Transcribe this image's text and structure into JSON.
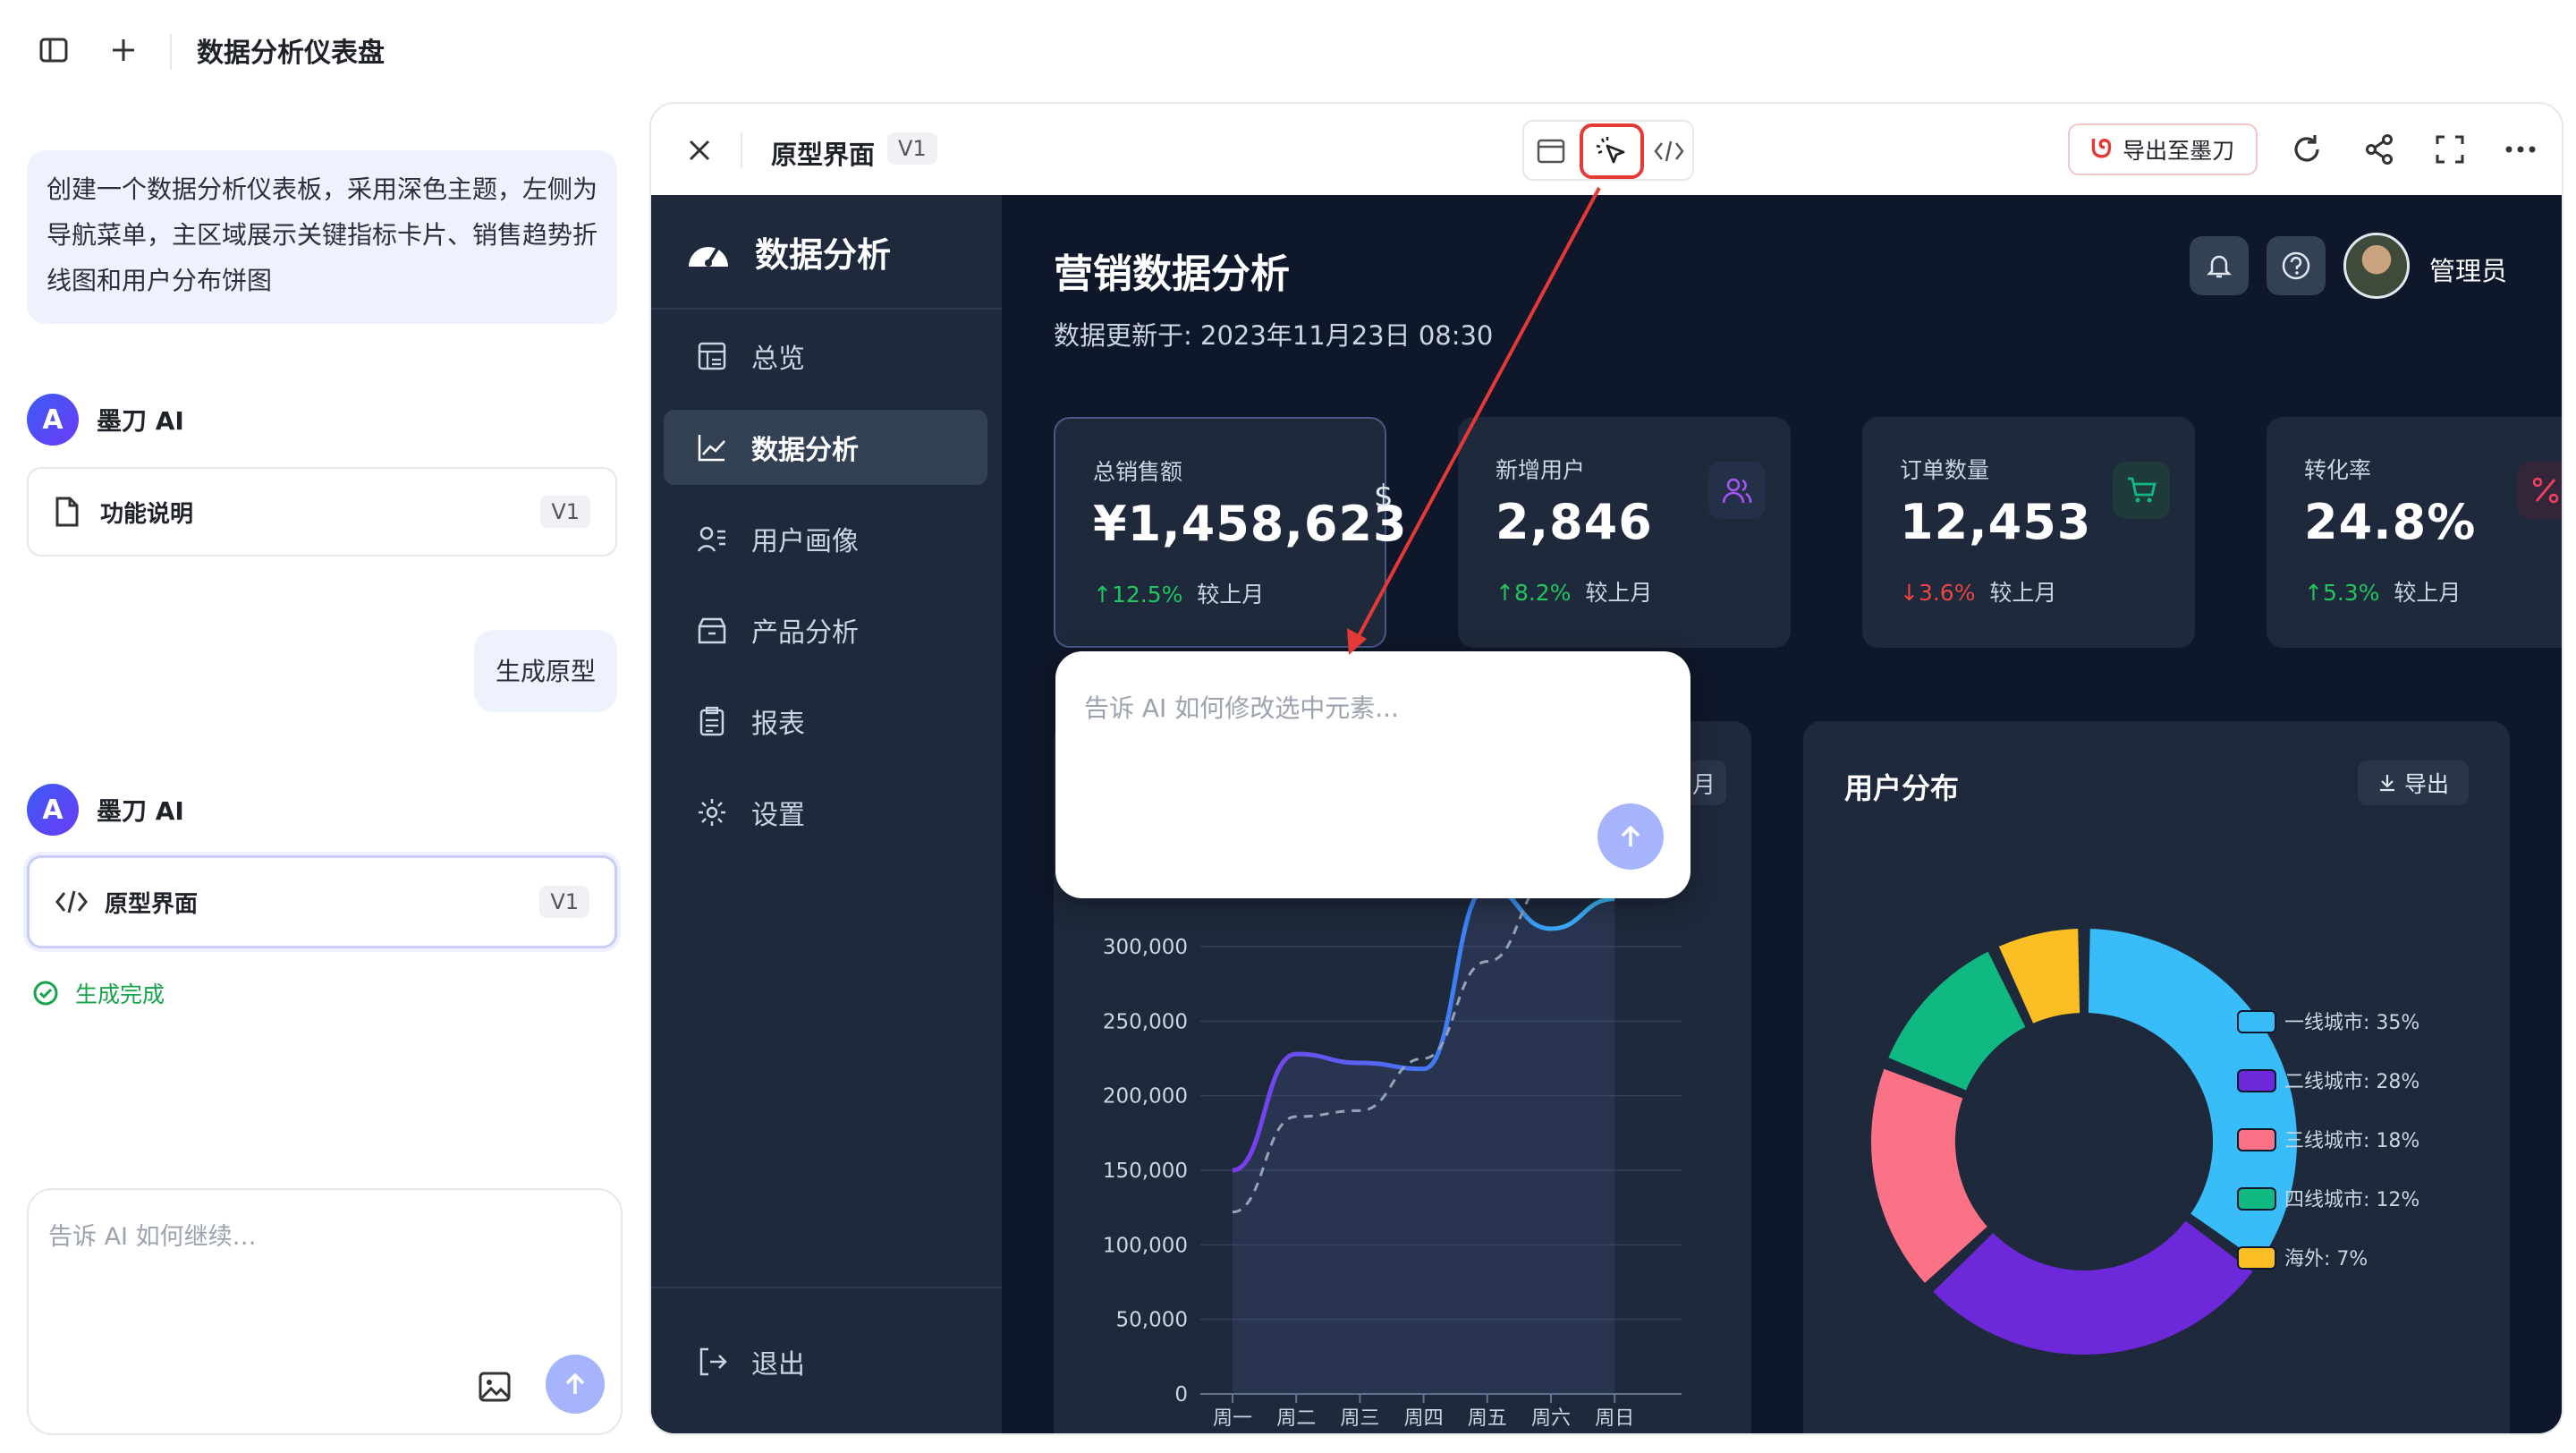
{
  "topbar": {
    "title": "数据分析仪表盘"
  },
  "chat": {
    "user_prompt": "创建一个数据分析仪表板，采用深色主题，左侧为导航菜单，主区域展示关键指标卡片、销售趋势折线图和用户分布饼图",
    "ai_name": "墨刀 AI",
    "card1": {
      "label": "功能说明",
      "version": "V1"
    },
    "user_msg2": "生成原型",
    "card2": {
      "label": "原型界面",
      "version": "V1"
    },
    "status": "生成完成",
    "input_placeholder": "告诉 AI 如何继续…"
  },
  "preview": {
    "title": "原型界面",
    "version": "V1",
    "export_label": "导出至墨刀"
  },
  "proto": {
    "brand": "数据分析",
    "nav": [
      "总览",
      "数据分析",
      "用户画像",
      "产品分析",
      "报表",
      "设置"
    ],
    "logout": "退出",
    "page_title": "营销数据分析",
    "updated": "数据更新于: 2023年11月23日 08:30",
    "user": "管理员",
    "kpis": [
      {
        "title": "总销售额",
        "value": "¥1,458,623",
        "delta": "↑12.5%",
        "suffix": "较上月",
        "color": "#22c55e"
      },
      {
        "title": "新增用户",
        "value": "2,846",
        "delta": "↑8.2%",
        "suffix": "较上月",
        "color": "#22c55e"
      },
      {
        "title": "订单数量",
        "value": "12,453",
        "delta": "↓3.6%",
        "suffix": "较上月",
        "color": "#ef4444"
      },
      {
        "title": "转化率",
        "value": "24.8%",
        "delta": "↑5.3%",
        "suffix": "较上月",
        "color": "#22c55e"
      }
    ],
    "edit_placeholder": "告诉 AI 如何修改选中元素...",
    "sales_chip": "月",
    "user_dist": {
      "title": "用户分布",
      "export": "导出"
    }
  },
  "chart_data": [
    {
      "type": "line",
      "categories": [
        "周一",
        "周二",
        "周三",
        "周四",
        "周五",
        "周六",
        "周日"
      ],
      "ylim": [
        0,
        300000
      ],
      "yticks": [
        "0",
        "50,000",
        "100,000",
        "150,000",
        "200,000",
        "250,000",
        "300,000"
      ],
      "series": [
        {
          "values": [
            150000,
            228000,
            222000,
            218000,
            340000,
            312000,
            332000
          ],
          "color": "#6366f1"
        },
        {
          "values": [
            122000,
            186000,
            190000,
            225000,
            290000,
            345000,
            365000
          ],
          "color": "#94a3b8"
        }
      ]
    },
    {
      "type": "pie",
      "labels": [
        "一线城市: 35%",
        "二线城市: 28%",
        "三线城市: 18%",
        "四线城市: 12%",
        "海外: 7%"
      ],
      "values": [
        35,
        28,
        18,
        12,
        7
      ],
      "colors": [
        "#38bdf8",
        "#6d28d9",
        "#fb7185",
        "#10b981",
        "#fbbf24"
      ]
    }
  ]
}
